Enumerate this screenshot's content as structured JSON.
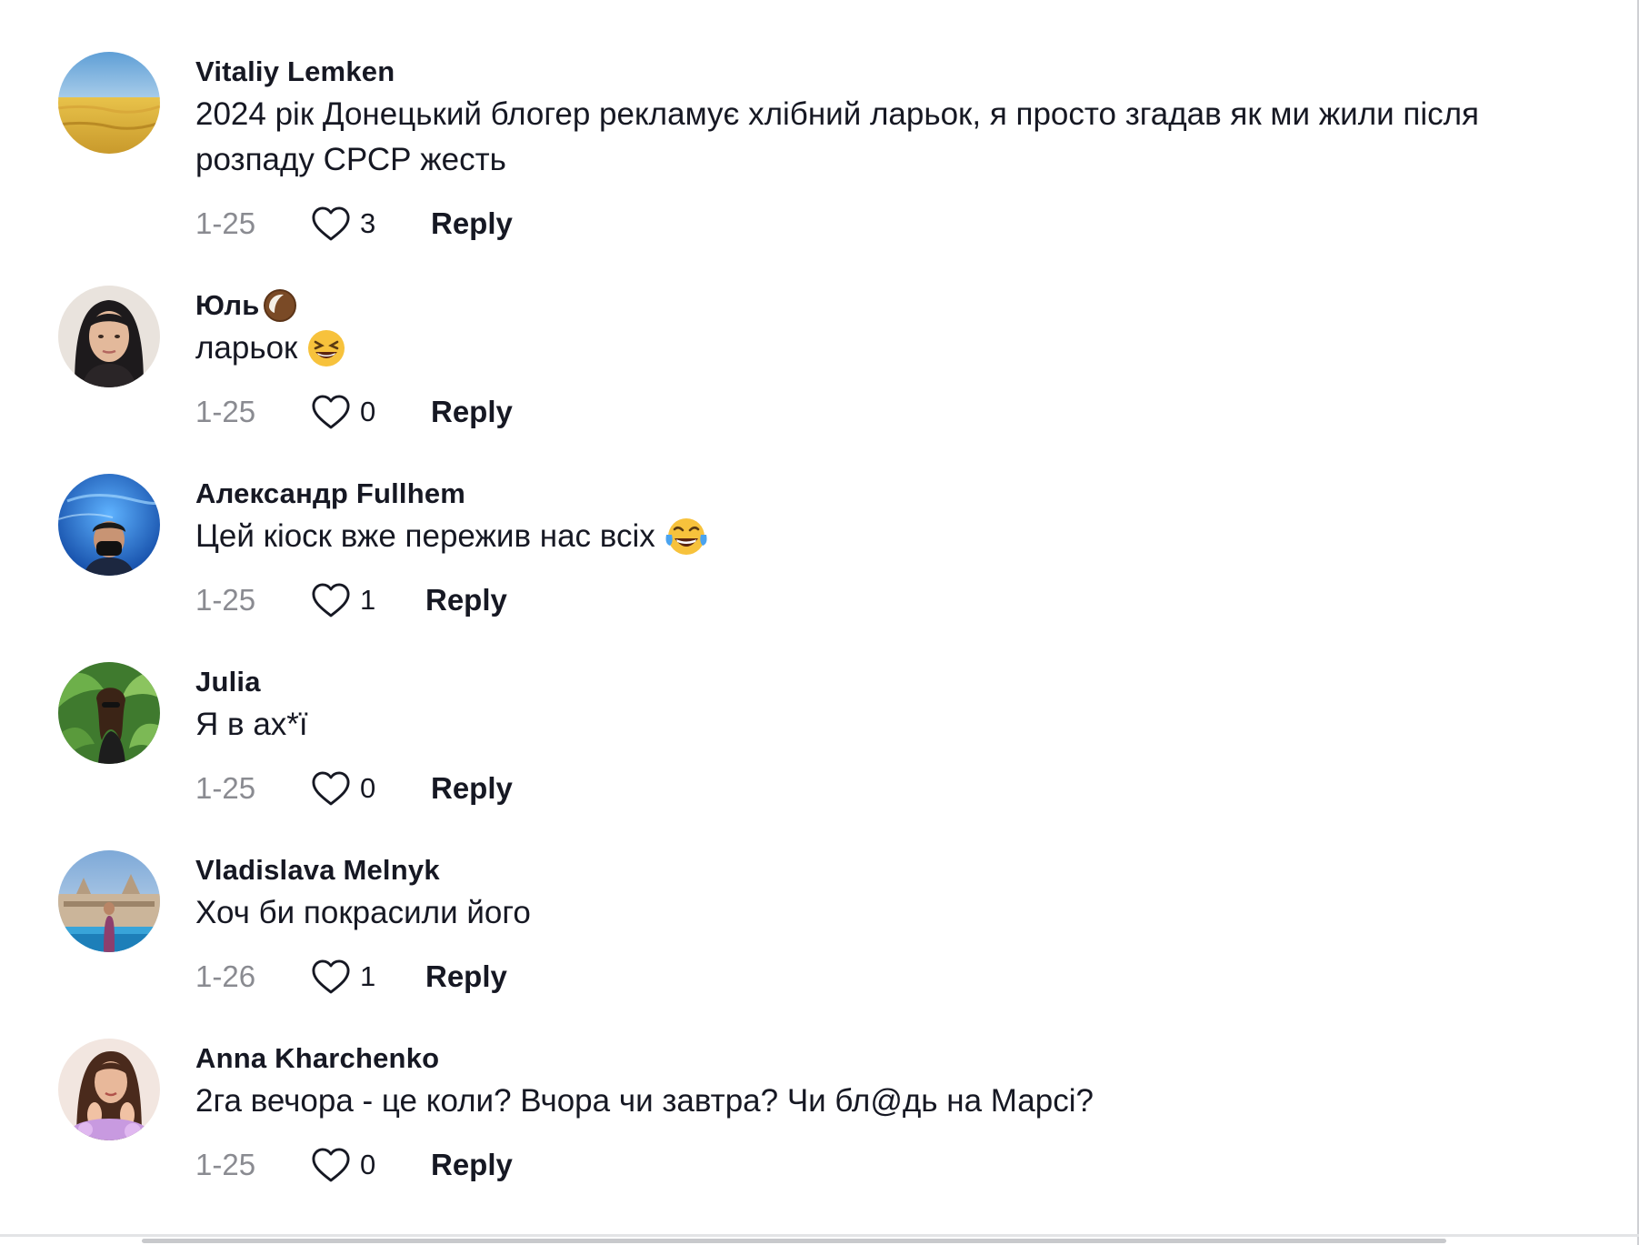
{
  "comments": [
    {
      "username": "Vitaliy Lemken",
      "text_lines": [
        "2024 рік Донецький блогер рекламує хлібний ларьок, я просто згадав як ми жили після",
        "розпаду СРСР жесть"
      ],
      "date": "1-25",
      "likes": "3",
      "reply": "Reply",
      "avatar": "wheat-field-avatar"
    },
    {
      "username": "Юль",
      "username_emoji": "coconut-emoji",
      "text": "ларьок",
      "text_emoji": "grinning-squinting-face-emoji",
      "date": "1-25",
      "likes": "0",
      "reply": "Reply",
      "avatar": "woman-portrait-avatar"
    },
    {
      "username": "Александр Fullhem",
      "text": "Цей кіоск вже пережив нас всіх",
      "text_emoji": "tears-of-joy-emoji",
      "date": "1-25",
      "likes": "1",
      "reply": "Reply",
      "avatar": "man-aquarium-avatar"
    },
    {
      "username": "Julia",
      "text": "Я в ах*ї",
      "date": "1-25",
      "likes": "0",
      "reply": "Reply",
      "avatar": "woman-palm-leaves-avatar"
    },
    {
      "username": "Vladislava Melnyk",
      "text": "Хоч би покрасили його",
      "date": "1-26",
      "likes": "1",
      "reply": "Reply",
      "avatar": "woman-palace-pool-avatar"
    },
    {
      "username": "Anna Kharchenko",
      "text": "2га вечора - це коли? Вчора чи завтра? Чи бл@дь на Марсі?",
      "date": "1-25",
      "likes": "0",
      "reply": "Reply",
      "avatar": "woman-flowers-avatar"
    }
  ],
  "colors": {
    "text": "#161823",
    "secondary": "#8a8b91",
    "like_outline": "#161823"
  }
}
